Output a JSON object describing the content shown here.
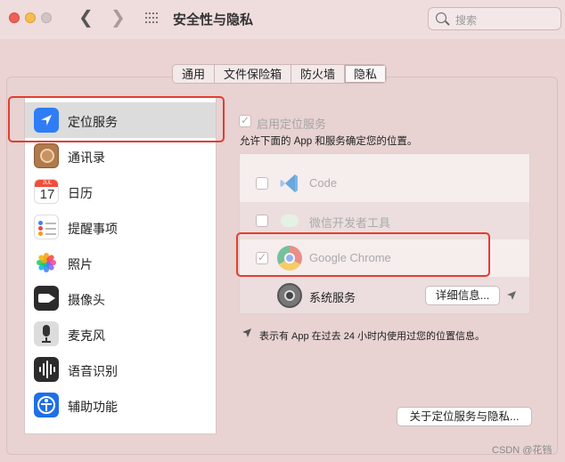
{
  "window": {
    "title": "安全性与隐私",
    "search_placeholder": "搜索"
  },
  "tabs": [
    {
      "label": "通用"
    },
    {
      "label": "文件保险箱"
    },
    {
      "label": "防火墙"
    },
    {
      "label": "隐私",
      "active": true
    }
  ],
  "sidebar": {
    "items": [
      {
        "label": "定位服务",
        "icon": "location-arrow-icon",
        "selected": true
      },
      {
        "label": "通讯录",
        "icon": "contacts-icon"
      },
      {
        "label": "日历",
        "icon": "calendar-icon",
        "month": "JUL",
        "day": "17"
      },
      {
        "label": "提醒事项",
        "icon": "reminders-icon"
      },
      {
        "label": "照片",
        "icon": "photos-icon"
      },
      {
        "label": "摄像头",
        "icon": "camera-icon"
      },
      {
        "label": "麦克风",
        "icon": "microphone-icon"
      },
      {
        "label": "语音识别",
        "icon": "speech-recognition-icon"
      },
      {
        "label": "辅助功能",
        "icon": "accessibility-icon"
      }
    ]
  },
  "location": {
    "enable_label": "启用定位服务",
    "enable_checked": true,
    "description": "允许下面的 App 和服务确定您的位置。",
    "apps": [
      {
        "name": "Code",
        "checked": false,
        "icon": "vscode-icon"
      },
      {
        "name": "微信开发者工具",
        "checked": false,
        "icon": "wechat-devtools-icon"
      },
      {
        "name": "Google Chrome",
        "checked": true,
        "icon": "chrome-icon"
      },
      {
        "name": "系统服务",
        "icon": "system-services-icon",
        "detail_label": "详细信息..."
      }
    ],
    "hint": "表示有 App 在过去 24 小时内使用过您的位置信息。",
    "about_label": "关于定位服务与隐私..."
  },
  "colors": {
    "highlight": "#e43d30",
    "accent": "#2f7df6"
  },
  "watermark": "CSDN @花铛"
}
